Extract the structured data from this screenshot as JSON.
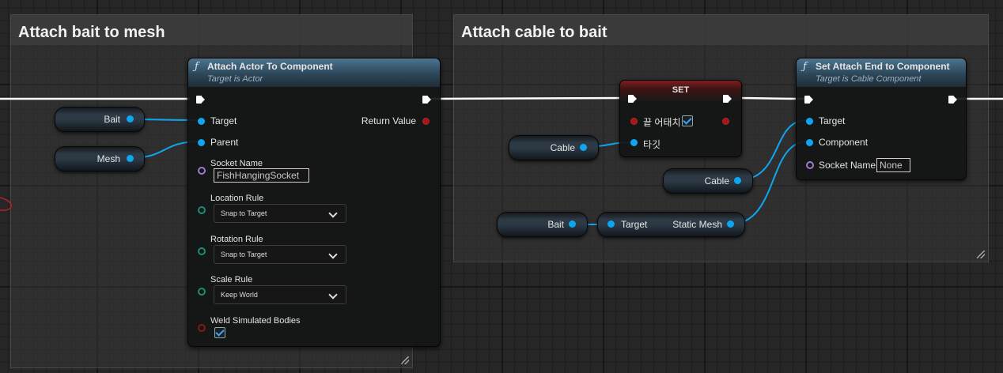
{
  "colors": {
    "wire_object": "#0fa6f0",
    "wire_exec": "#ffffff",
    "set_node_header": "#7a1f1f",
    "function_header": "#2c4759"
  },
  "comments": {
    "left": {
      "title": "Attach bait to mesh"
    },
    "right": {
      "title": "Attach cable to bait"
    }
  },
  "attach_actor_node": {
    "icon": "function-icon",
    "title": "Attach Actor To Component",
    "subtitle": "Target is Actor",
    "pins": {
      "target": "Target",
      "parent": "Parent",
      "return_value": "Return Value",
      "socket_name": "Socket Name",
      "socket_value": "FishHangingSocket",
      "location_rule": "Location Rule",
      "location_value": "Snap to Target",
      "rotation_rule": "Rotation Rule",
      "rotation_value": "Snap to Target",
      "scale_rule": "Scale Rule",
      "scale_value": "Keep World",
      "weld": "Weld Simulated Bodies",
      "weld_checked": true
    }
  },
  "variables": {
    "bait_left": "Bait",
    "mesh_left": "Mesh",
    "cable_set": "Cable",
    "cable_attach": "Cable",
    "bait_right": "Bait"
  },
  "set_node": {
    "title": "SET",
    "bool_label": "끝 어태치",
    "bool_checked": true,
    "target_label": "타깃"
  },
  "static_mesh_node": {
    "target": "Target",
    "output": "Static Mesh"
  },
  "attach_end_node": {
    "icon": "function-icon",
    "title": "Set Attach End to Component",
    "subtitle": "Target is Cable Component",
    "pins": {
      "target": "Target",
      "component": "Component",
      "socket_name": "Socket Name",
      "socket_value": "None"
    }
  }
}
